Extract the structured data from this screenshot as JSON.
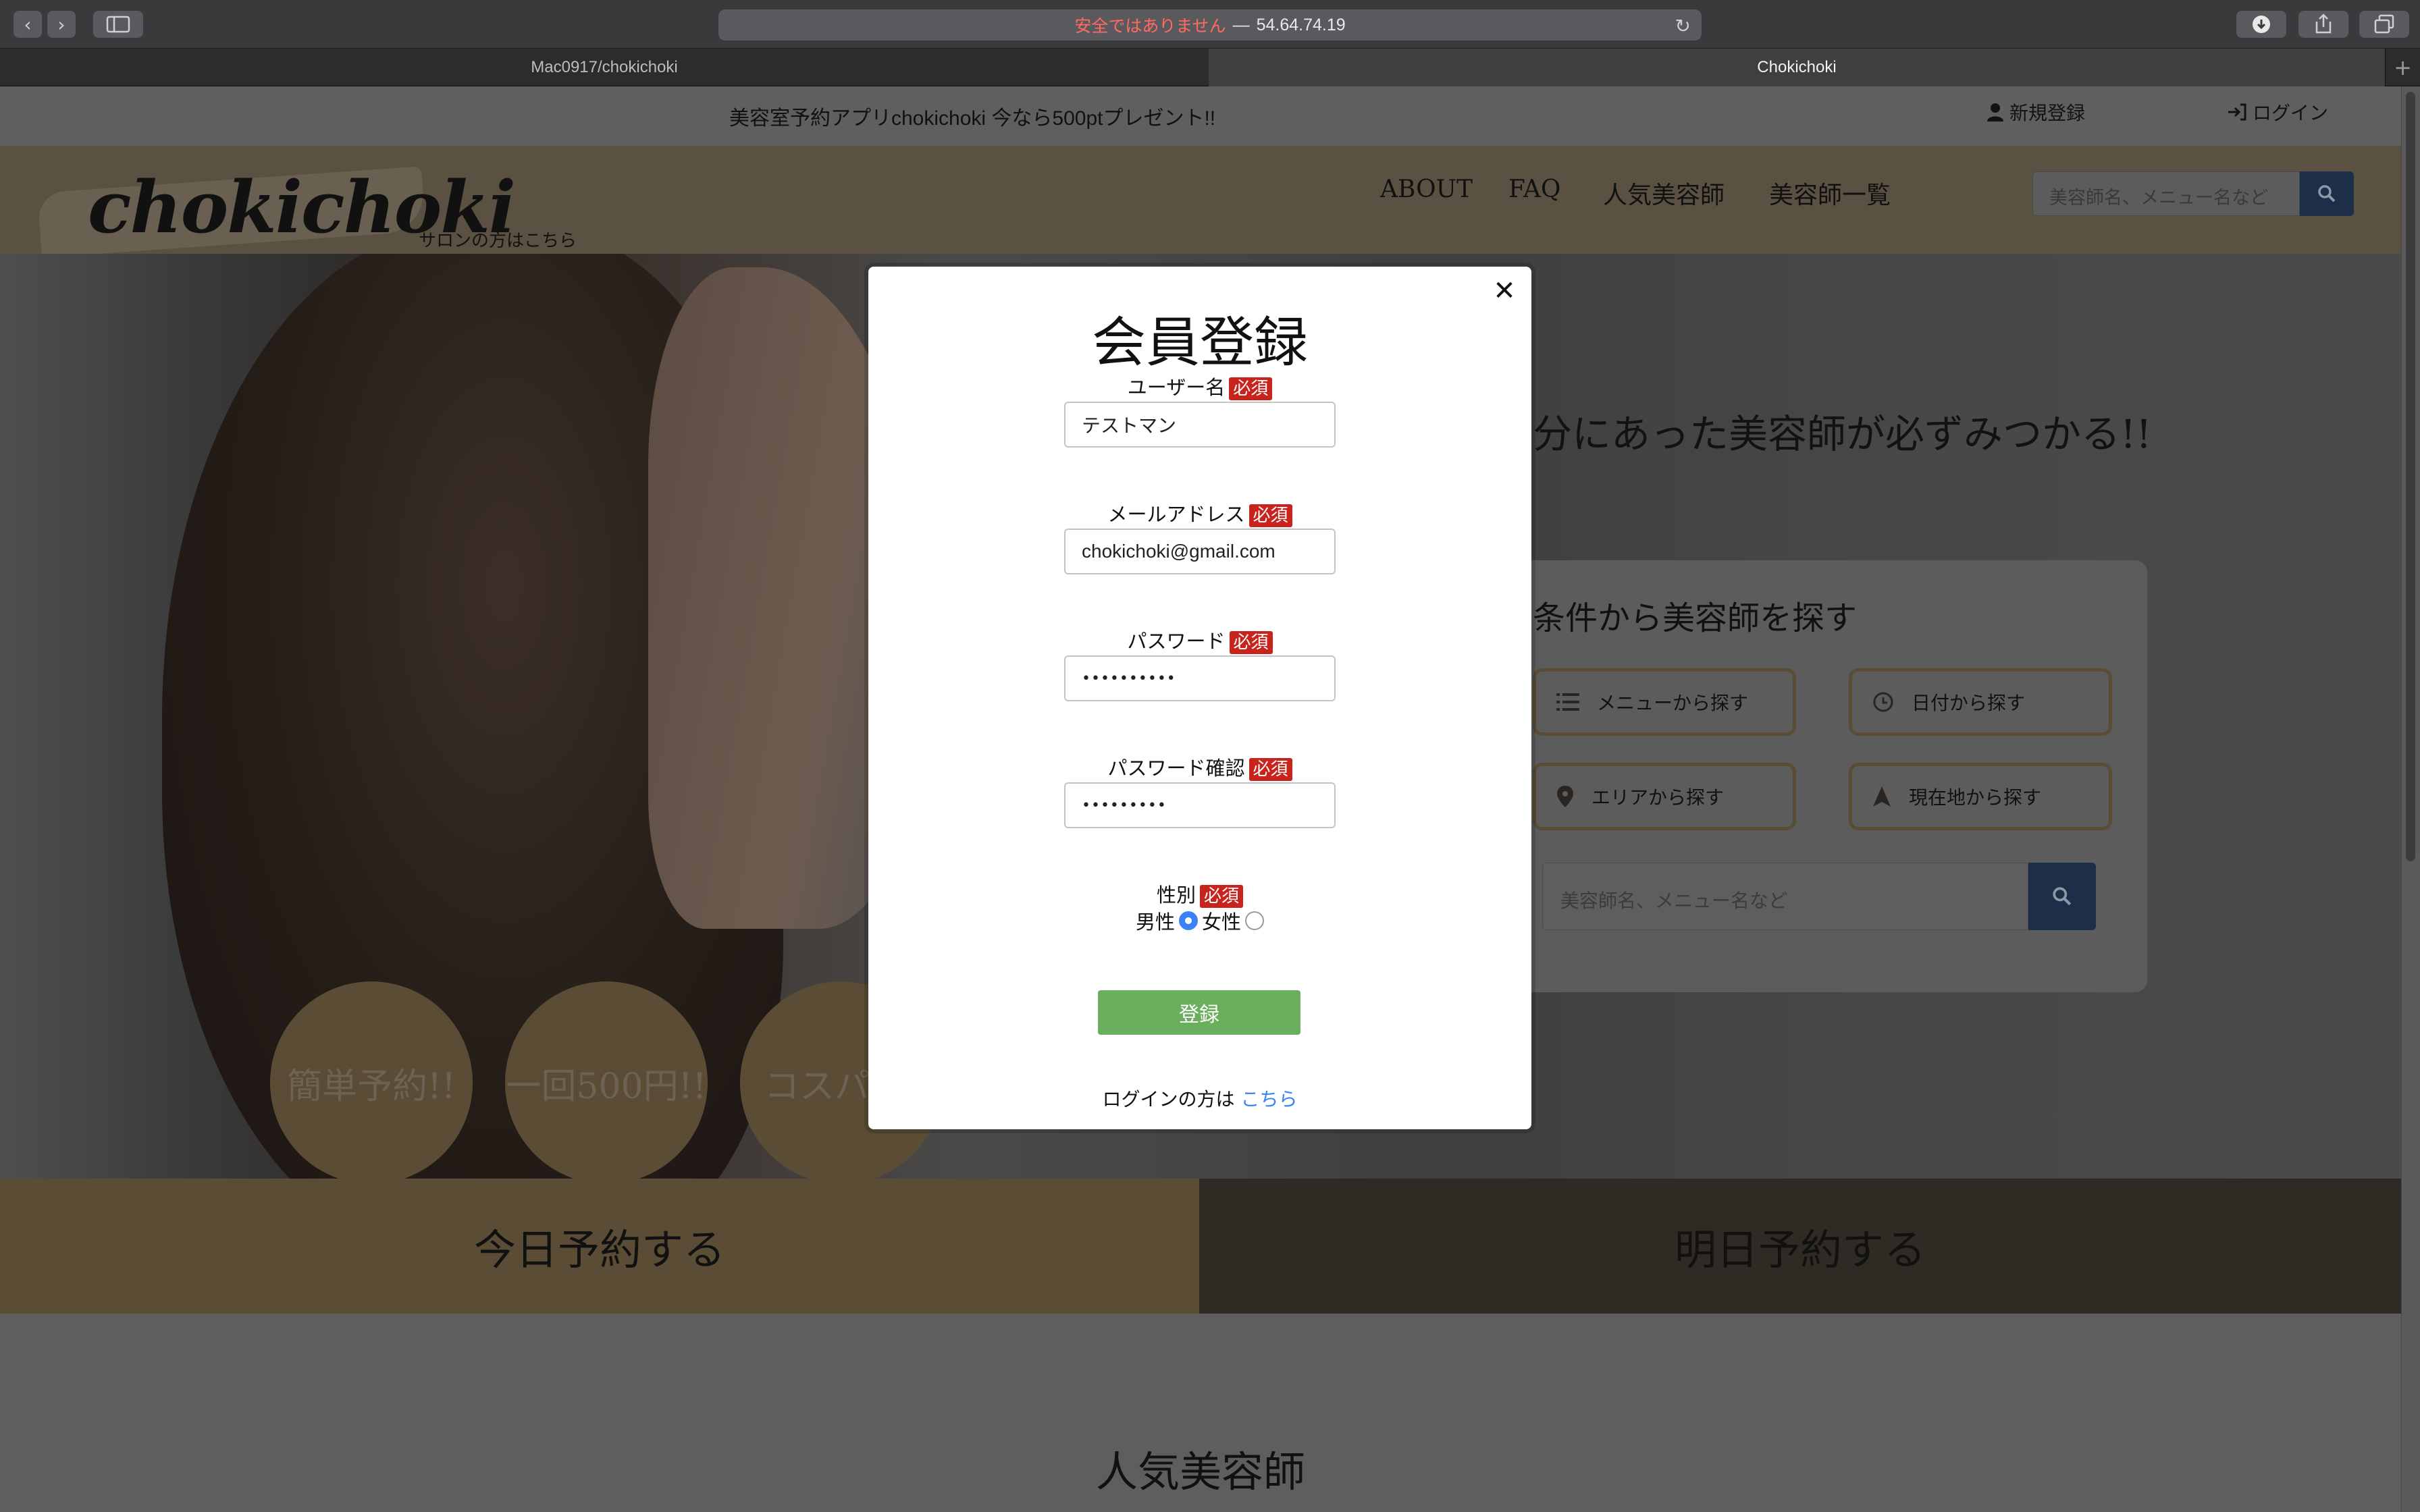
{
  "browser": {
    "url_insecure": "安全ではありません",
    "url_separator": "—",
    "url": "54.64.74.19",
    "tabs": [
      {
        "label": "Mac0917/chokichoki",
        "active": false
      },
      {
        "label": "Chokichoki",
        "active": true
      }
    ]
  },
  "topbar": {
    "announcement": "美容室予約アプリchokichoki 今なら500ptプレゼント!!",
    "signup": "新規登録",
    "login": "ログイン"
  },
  "header": {
    "logo": "chokichoki",
    "salon_link": "サロンの方はこちら",
    "nav": [
      "ABOUT",
      "FAQ",
      "人気美容師",
      "美容師一覧"
    ],
    "search_placeholder": "美容師名、メニュー名など"
  },
  "hero": {
    "title": "分にあった美容師が必ずみつかる!!",
    "panel_title": "条件から美容師を探す",
    "buttons": {
      "menu": "メニューから探す",
      "date": "日付から探す",
      "area": "エリアから探す",
      "location": "現在地から探す"
    },
    "search_placeholder": "美容師名、メニュー名など",
    "circles": [
      "簡単予約!!",
      "一回500円!!",
      "コスパ"
    ]
  },
  "booking": {
    "today": "今日予約する",
    "tomorrow": "明日予約する"
  },
  "sections": {
    "popular": "人気美容師"
  },
  "modal": {
    "title": "会員登録",
    "required_badge": "必須",
    "username_label": "ユーザー名",
    "username_value": "テストマン",
    "email_label": "メールアドレス",
    "email_value": "chokichoki@gmail.com",
    "password_label": "パスワード",
    "password_mask": "••••••••••",
    "password_confirm_label": "パスワード確認",
    "password_confirm_mask": "•••••••••",
    "gender_label": "性別",
    "gender_male": "男性",
    "gender_female": "女性",
    "gender_selected": "男性",
    "submit": "登録",
    "login_hint": "ログインの方は",
    "login_link": "こちら"
  },
  "colors": {
    "accent_green": "#6aaf5e",
    "required_red": "#c8231d",
    "link_blue": "#3b82f6",
    "search_navy": "#1c2e48",
    "brand_tan": "#b89b6c"
  }
}
